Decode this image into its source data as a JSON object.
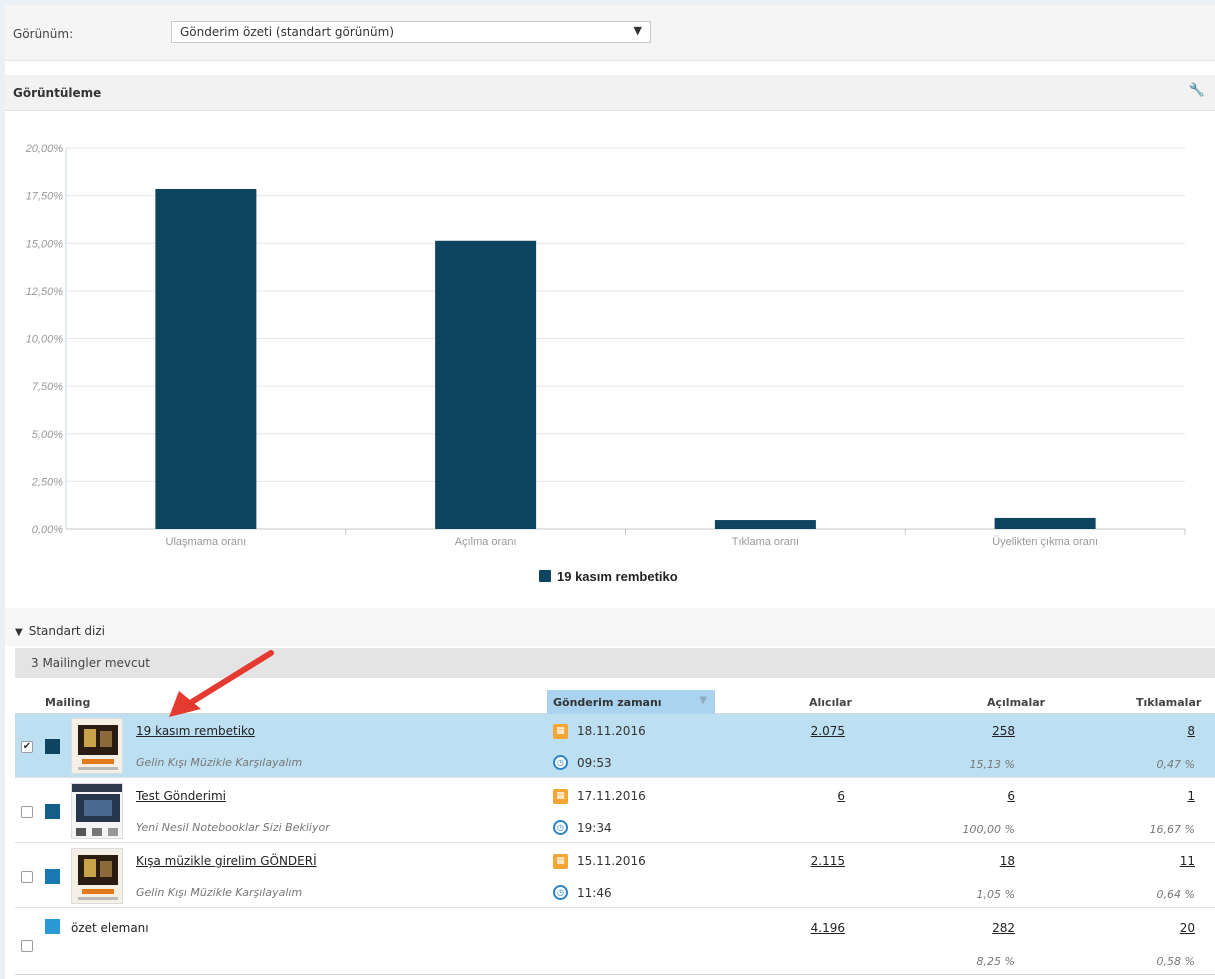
{
  "view": {
    "label": "Görünüm:",
    "selected": "Gönderim özeti (standart görünüm)"
  },
  "panel": {
    "title": "Görüntüleme"
  },
  "chart_data": {
    "type": "bar",
    "categories": [
      "Ulaşmama oranı",
      "Açılma oranı",
      "Tıklama oranı",
      "Üyelikten çıkma oranı"
    ],
    "series": [
      {
        "name": "19 kasım rembetiko",
        "values": [
          17.85,
          15.13,
          0.47,
          0.58
        ],
        "color": "#0f4460"
      }
    ],
    "ylim": [
      0,
      20
    ],
    "yticks": [
      "0,00%",
      "2,50%",
      "5,00%",
      "7,50%",
      "10,00%",
      "12,50%",
      "15,00%",
      "17,50%",
      "20,00%"
    ],
    "grid": true,
    "legend_position": "bottom"
  },
  "std": {
    "title": "Standart dizi",
    "count_label": "3 Mailingler mevcut"
  },
  "columns": {
    "mailing": "Mailing",
    "send_time": "Gönderim zamanı",
    "recipients": "Alıcılar",
    "opens": "Açılmalar",
    "clicks": "Tıklamalar"
  },
  "rows": [
    {
      "name": "19 kasım rembetiko",
      "subject": "Gelin Kışı Müzikle Karşılayalım",
      "date": "18.11.2016",
      "time": "09:53",
      "recipients": "2.075",
      "opens": "258",
      "open_rate": "15,13 %",
      "clicks": "8",
      "click_rate": "0,47 %",
      "checked": "✔",
      "color": "#0f4460"
    },
    {
      "name": "Test Gönderimi",
      "subject": "Yeni Nesil Notebooklar Sizi Bekliyor",
      "date": "17.11.2016",
      "time": "19:34",
      "recipients": "6",
      "opens": "6",
      "open_rate": "100,00 %",
      "clicks": "1",
      "click_rate": "16,67 %",
      "checked": "",
      "color": "#135f8a"
    },
    {
      "name": "Kışa müzikle girelim GÖNDERİ",
      "subject": "Gelin Kışı Müzikle Karşılayalım",
      "date": "15.11.2016",
      "time": "11:46",
      "recipients": "2.115",
      "opens": "18",
      "open_rate": "1,05 %",
      "clicks": "11",
      "click_rate": "0,64 %",
      "checked": "",
      "color": "#1a79b3"
    }
  ],
  "summary": {
    "label": "özet elemanı",
    "recipients": "4.196",
    "opens": "282",
    "open_rate": "8,25 %",
    "clicks": "20",
    "click_rate": "0,58 %",
    "color": "#2a9ad6"
  }
}
